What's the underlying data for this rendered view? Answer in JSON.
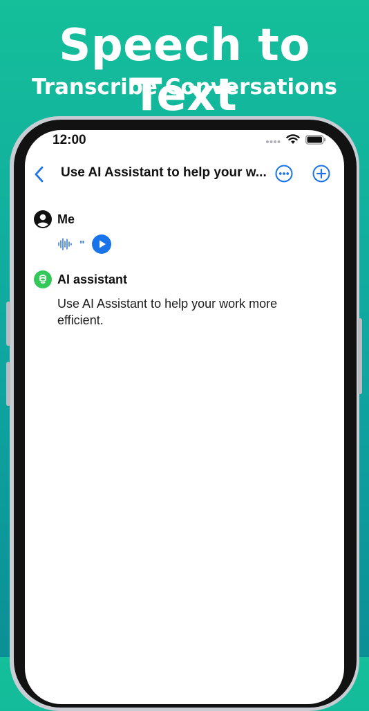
{
  "promo": {
    "headline": "Speech to Text",
    "subheadline": "Transcribe Conversations"
  },
  "status_bar": {
    "time": "12:00"
  },
  "nav": {
    "title": "Use AI Assistant to help your w...",
    "back_icon": "chevron-left-icon",
    "more_icon": "ellipsis-circle-icon",
    "add_icon": "plus-circle-icon"
  },
  "messages": [
    {
      "sender": "Me",
      "avatar_icon": "person-circle-icon",
      "audio_quote": "\""
    },
    {
      "sender": "AI assistant",
      "avatar_icon": "ai-logo-icon",
      "text": "Use AI Assistant to help your work more efficient."
    }
  ],
  "colors": {
    "accent": "#1a73e8",
    "ai_logo": "#34c759",
    "background_top": "#15bf9a",
    "background_bottom": "#0b8f96"
  }
}
